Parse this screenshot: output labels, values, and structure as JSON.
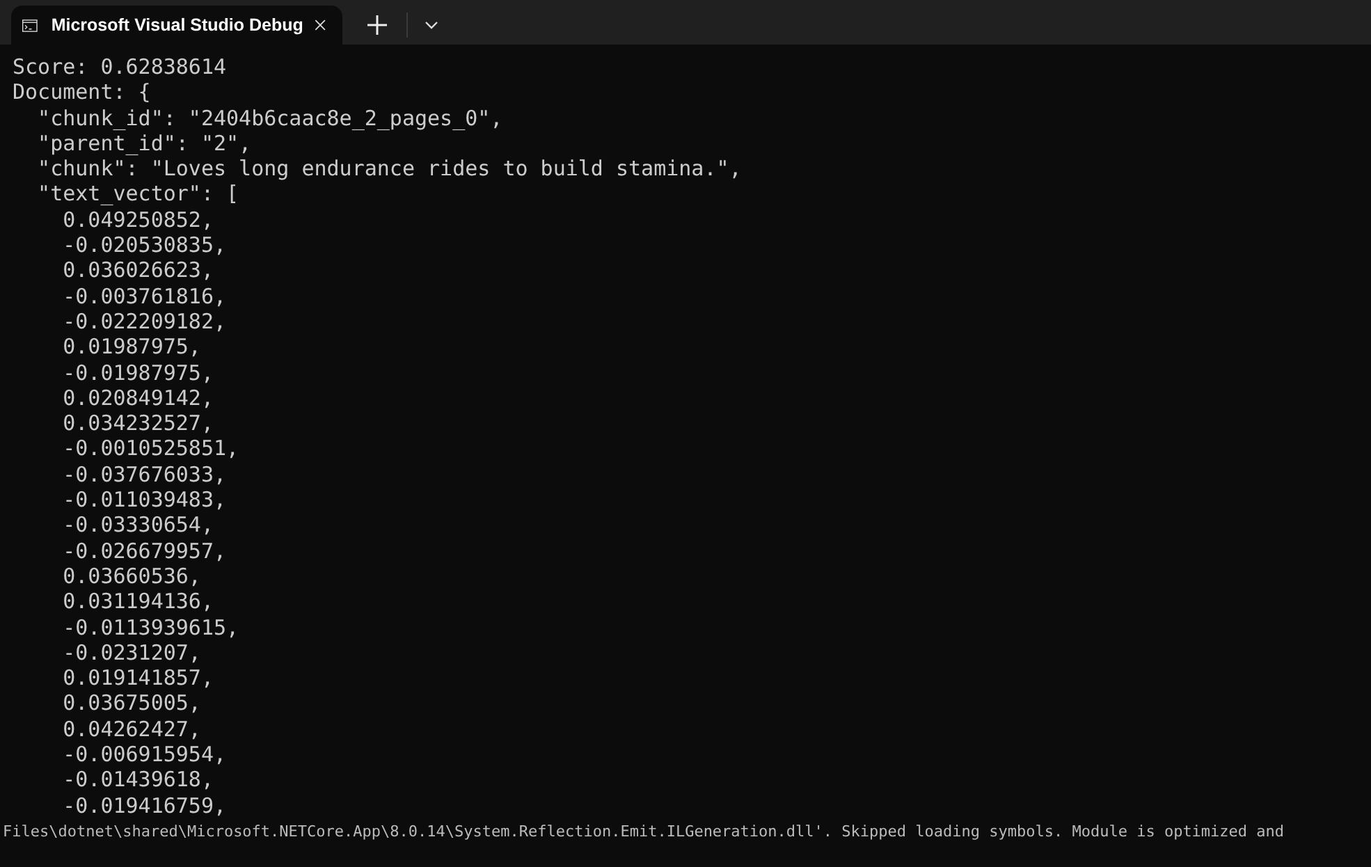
{
  "tab": {
    "title": "Microsoft Visual Studio Debug",
    "selected": true
  },
  "console_lines": [
    "Score: 0.62838614",
    "Document: {",
    "  \"chunk_id\": \"2404b6caac8e_2_pages_0\",",
    "  \"parent_id\": \"2\",",
    "  \"chunk\": \"Loves long endurance rides to build stamina.\",",
    "  \"text_vector\": [",
    "    0.049250852,",
    "    -0.020530835,",
    "    0.036026623,",
    "    -0.003761816,",
    "    -0.022209182,",
    "    0.01987975,",
    "    -0.01987975,",
    "    0.020849142,",
    "    0.034232527,",
    "    -0.0010525851,",
    "    -0.037676033,",
    "    -0.011039483,",
    "    -0.03330654,",
    "    -0.026679957,",
    "    0.03660536,",
    "    0.031194136,",
    "    -0.0113939615,",
    "    -0.0231207,",
    "    0.019141857,",
    "    0.03675005,",
    "    0.04262427,",
    "    -0.006915954,",
    "    -0.01439618,",
    "    -0.019416759,"
  ],
  "log_line": "Files\\dotnet\\shared\\Microsoft.NETCore.App\\8.0.14\\System.Reflection.Emit.ILGeneration.dll'. Skipped loading symbols. Module is optimized and"
}
